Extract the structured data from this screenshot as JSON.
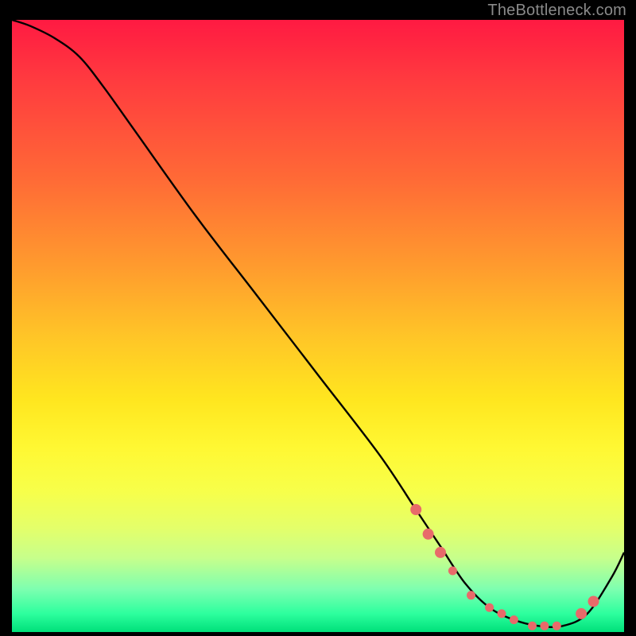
{
  "watermark": "TheBottleneck.com",
  "colors": {
    "background": "#000000",
    "curve": "#000000",
    "dot": "#e86a6a",
    "gradient_top": "#ff1a42",
    "gradient_bottom": "#00e07a"
  },
  "chart_data": {
    "type": "line",
    "title": "",
    "xlabel": "",
    "ylabel": "",
    "xlim": [
      0,
      100
    ],
    "ylim": [
      0,
      100
    ],
    "note": "Axes are unlabeled in the source image; values are relative percentages estimated from pixel position (x left→right, y bottom→top).",
    "series": [
      {
        "name": "curve",
        "x": [
          0,
          3,
          7,
          11,
          15,
          20,
          30,
          40,
          50,
          60,
          66,
          70,
          74,
          78,
          82,
          86,
          90,
          94,
          98,
          100
        ],
        "y": [
          100,
          99,
          97,
          94,
          89,
          82,
          68,
          55,
          42,
          29,
          20,
          14,
          8,
          4,
          2,
          1,
          1,
          3,
          9,
          13
        ]
      }
    ],
    "markers": {
      "name": "dots",
      "x": [
        66,
        68,
        70,
        72,
        75,
        78,
        80,
        82,
        85,
        87,
        89,
        93,
        95
      ],
      "y": [
        20,
        16,
        13,
        10,
        6,
        4,
        3,
        2,
        1,
        1,
        1,
        3,
        5
      ]
    }
  }
}
